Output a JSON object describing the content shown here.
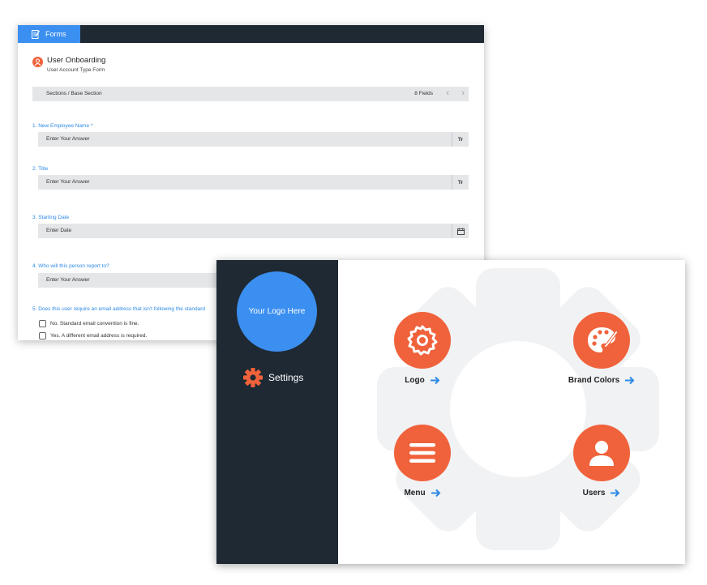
{
  "forms_window": {
    "tab_label": "Forms",
    "form_title": "User Onboarding",
    "form_subtitle": "User Account Type Form",
    "sections": {
      "path": "Sections / Base Section",
      "field_count": "8 Fields",
      "prev_icon": "chevron-left-icon",
      "next_icon": "chevron-right-icon"
    },
    "questions": [
      {
        "label": "1. New Employee Name *",
        "placeholder": "Enter Your Answer",
        "suffix": "Tr"
      },
      {
        "label": "2. Title",
        "placeholder": "Enter Your Answer",
        "suffix": "Tr"
      },
      {
        "label": "3. Starting Date",
        "placeholder": "Enter Date",
        "suffix_icon": "calendar-icon"
      },
      {
        "label": "4. Who will this person report to?",
        "placeholder": "Enter Your Answer"
      },
      {
        "label": "5. Does this user require an email address that isn't following the standard"
      }
    ],
    "options": [
      "No. Standard email convention is fine.",
      "Yes. A different email address is required."
    ]
  },
  "settings_window": {
    "logo_placeholder": "Your Logo Here",
    "sidebar_item": "Settings",
    "tiles": [
      {
        "label": "Logo",
        "icon": "gear-icon"
      },
      {
        "label": "Brand Colors",
        "icon": "palette-icon"
      },
      {
        "label": "Menu",
        "icon": "menu-icon"
      },
      {
        "label": "Users",
        "icon": "user-icon"
      }
    ]
  },
  "colors": {
    "accent_blue": "#3b8ff0",
    "accent_orange": "#f0623b",
    "dark_sidebar": "#1f2933",
    "field_bg": "#e4e6e8"
  }
}
